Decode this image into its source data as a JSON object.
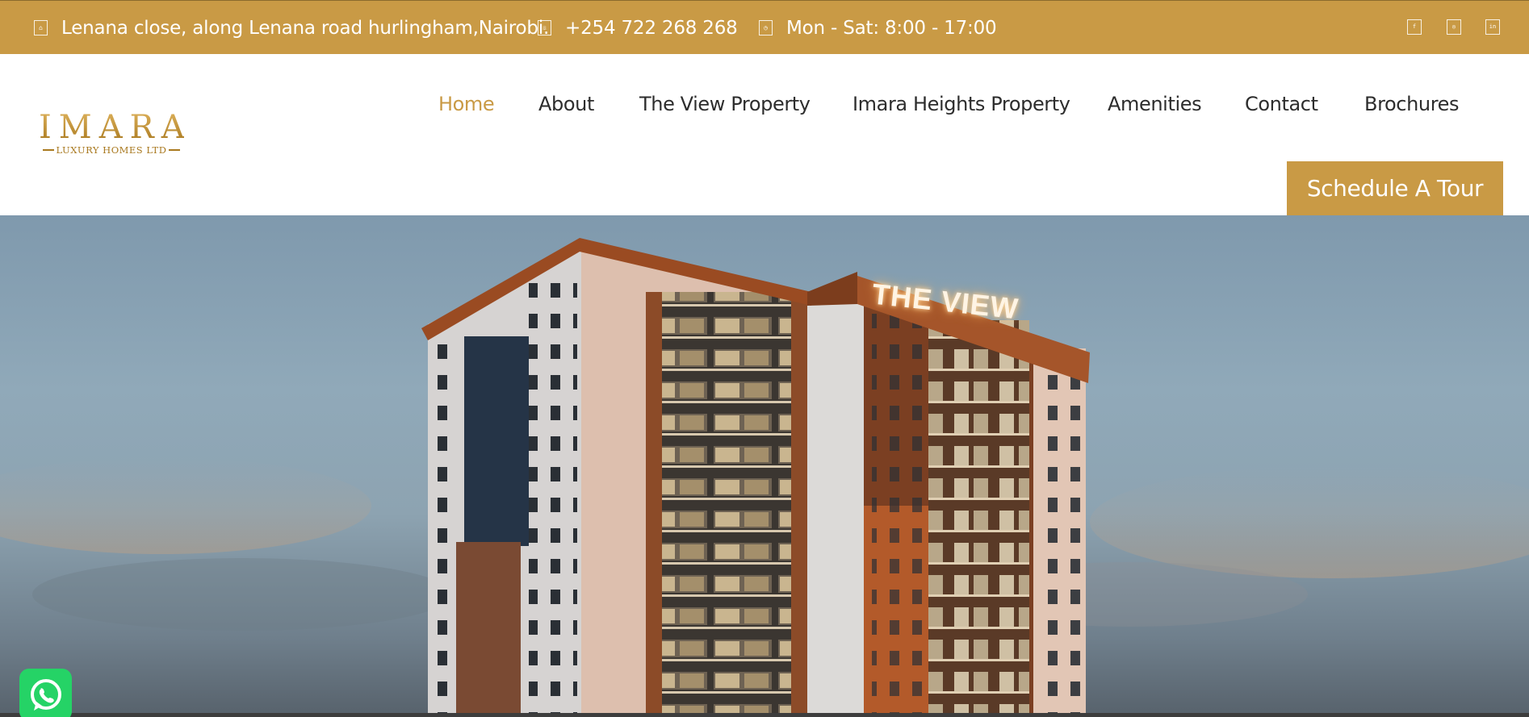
{
  "topbar": {
    "address": {
      "icon": "location-icon",
      "glyph": "⌂",
      "text": "Lenana close, along Lenana road hurlingham,Nairobi."
    },
    "phone": {
      "icon": "phone-icon",
      "glyph": "☏",
      "text": "+254 722 268 268"
    },
    "hours": {
      "icon": "clock-icon",
      "glyph": "◷",
      "text": "Mon - Sat: 8:00 - 17:00"
    },
    "social": [
      {
        "icon": "facebook-icon",
        "glyph": "f"
      },
      {
        "icon": "instagram-icon",
        "glyph": "◎"
      },
      {
        "icon": "linkedin-icon",
        "glyph": "in"
      }
    ]
  },
  "logo": {
    "main": "IMARA",
    "sub": "LUXURY HOMES LTD"
  },
  "nav": {
    "items": [
      "Home",
      "About",
      "The View Property",
      "Imara Heights Property",
      "Amenities",
      "Contact",
      "Brochures"
    ],
    "active": "Home"
  },
  "cta": {
    "label": "Schedule A Tour"
  },
  "hero": {
    "sign": "THE VIEW"
  },
  "colors": {
    "accent": "#c99a45",
    "text": "#2d2d2d",
    "whatsapp": "#25d366"
  },
  "widgets": {
    "chat": "whatsapp-icon"
  }
}
